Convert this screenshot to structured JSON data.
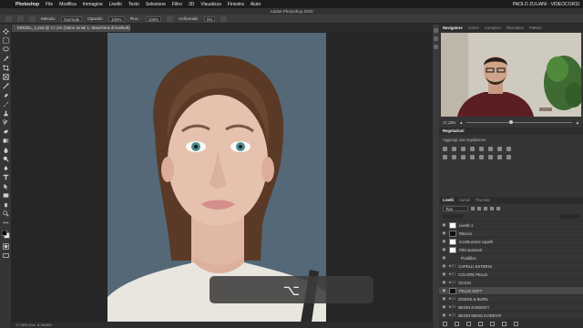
{
  "menubar": {
    "app": "Photoshop",
    "items": [
      "File",
      "Modifica",
      "Immagine",
      "Livello",
      "Testo",
      "Selezione",
      "Filtro",
      "3D",
      "Visualizza",
      "Finestra",
      "Aiuto"
    ],
    "user": "PAOLO ZULIANI - VIDEOCORSI"
  },
  "window": {
    "title": "Adobe Photoshop 2020"
  },
  "options": {
    "mode_label": "Metodo:",
    "mode_value": "Normale",
    "opacity_label": "Opacità:",
    "opacity_value": "100%",
    "flow_label": "Flus.:",
    "flow_value": "100%",
    "smoothing_label": "Uniformità:",
    "smoothing_value": "0%"
  },
  "document": {
    "tab": "MODEL_1.psd @ 17,1% (Valori tonali 1, Maschera di livello/8) *"
  },
  "hud": {
    "symbol": "⌥"
  },
  "status": {
    "text": "17,08%   Doc: 8,3M/8M"
  },
  "panels": {
    "top_tabs": [
      "Navigatore",
      "Colore",
      "Campioni",
      "Sfumature",
      "Pattern"
    ],
    "zoom": "17,13%",
    "adjustments_title": "Regolazioni",
    "adjustments_hint": "Aggiungi una regolazione",
    "layers_tabs": [
      "Livelli",
      "Canali",
      "Tracciati"
    ],
    "filter": "Tipo",
    "layers": [
      {
        "name": "Livello 1",
        "type": "thumb",
        "selected": false
      },
      {
        "name": "Ritocco",
        "type": "mask",
        "selected": false
      },
      {
        "name": "ricostruzione capelli",
        "type": "thumb",
        "selected": false
      },
      {
        "name": "Filtri avanzati",
        "type": "thumb",
        "selected": false
      },
      {
        "name": "Fluidifica",
        "type": "none",
        "selected": false
      },
      {
        "name": "CAPELLI ESTERNI",
        "type": "folder",
        "selected": false
      },
      {
        "name": "COLORE PELLE",
        "type": "folder",
        "selected": false
      },
      {
        "name": "OCCHI",
        "type": "folder",
        "selected": false
      },
      {
        "name": "PELLE SOFT",
        "type": "mask",
        "selected": false
      },
      {
        "name": "DODGE & BURN",
        "type": "folder",
        "selected": false
      },
      {
        "name": "BEGIN EVIDENTI",
        "type": "folder",
        "selected": false
      },
      {
        "name": "BEGIN MENO EVIDENTI",
        "type": "folder",
        "selected": false
      },
      {
        "name": "Sfondo",
        "type": "thumb",
        "selected": false
      }
    ]
  }
}
